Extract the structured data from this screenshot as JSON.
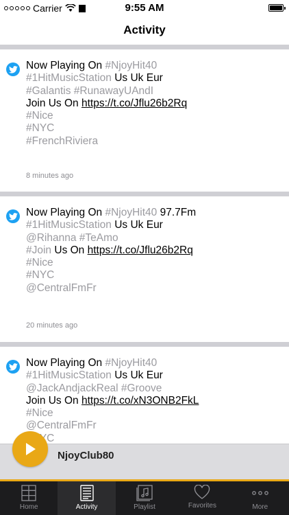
{
  "status_bar": {
    "carrier": "Carrier",
    "time": "9:55 AM"
  },
  "header": {
    "title": "Activity"
  },
  "feed": [
    {
      "lines": [
        [
          {
            "t": "Now Playing On ",
            "k": "text"
          },
          {
            "t": "#NjoyHit40",
            "k": "tag"
          }
        ],
        [
          {
            "t": "#1HitMusicStation",
            "k": "tag"
          },
          {
            "t": " Us Uk Eur",
            "k": "text"
          }
        ],
        [
          {
            "t": "#Galantis #RunawayUAndI",
            "k": "tag"
          }
        ],
        [
          {
            "t": "Join Us On ",
            "k": "text"
          },
          {
            "t": "https://t.co/Jflu26b2Rq",
            "k": "link"
          }
        ],
        [
          {
            "t": "#Nice",
            "k": "tag"
          }
        ],
        [
          {
            "t": "#NYC",
            "k": "tag"
          }
        ],
        [
          {
            "t": "#FrenchRiviera",
            "k": "tag"
          }
        ]
      ],
      "time_ago": "8 minutes ago"
    },
    {
      "lines": [
        [
          {
            "t": "Now Playing On ",
            "k": "text"
          },
          {
            "t": "#NjoyHit40",
            "k": "tag"
          },
          {
            "t": " 97.7Fm",
            "k": "text"
          }
        ],
        [
          {
            "t": "#1HitMusicStation",
            "k": "tag"
          },
          {
            "t": " Us Uk Eur",
            "k": "text"
          }
        ],
        [
          {
            "t": "@Rihanna #TeAmo",
            "k": "tag"
          }
        ],
        [
          {
            "t": "#Join",
            "k": "tag"
          },
          {
            "t": " Us On ",
            "k": "text"
          },
          {
            "t": "https://t.co/Jflu26b2Rq",
            "k": "link"
          }
        ],
        [
          {
            "t": "#Nice",
            "k": "tag"
          }
        ],
        [
          {
            "t": "#NYC",
            "k": "tag"
          }
        ],
        [
          {
            "t": "@CentralFmFr",
            "k": "tag"
          }
        ]
      ],
      "time_ago": "20 minutes ago"
    },
    {
      "lines": [
        [
          {
            "t": "Now Playing On ",
            "k": "text"
          },
          {
            "t": "#NjoyHit40",
            "k": "tag"
          }
        ],
        [
          {
            "t": "#1HitMusicStation",
            "k": "tag"
          },
          {
            "t": " Us Uk Eur",
            "k": "text"
          }
        ],
        [
          {
            "t": "@JackAndjackReal #Groove",
            "k": "tag"
          }
        ],
        [
          {
            "t": "Join Us On ",
            "k": "text"
          },
          {
            "t": "https://t.co/xN3ONB2FkL",
            "k": "link"
          }
        ],
        [
          {
            "t": "#Nice",
            "k": "tag"
          }
        ],
        [
          {
            "t": "@CentralFmFr",
            "k": "tag"
          }
        ],
        [
          {
            "t": "#NYC",
            "k": "tag"
          }
        ]
      ],
      "time_ago": ""
    }
  ],
  "player": {
    "station": "NjoyClub80"
  },
  "tabs": [
    {
      "label": "Home",
      "icon": "grid-icon"
    },
    {
      "label": "Activity",
      "icon": "document-icon"
    },
    {
      "label": "Playlist",
      "icon": "music-icon"
    },
    {
      "label": "Favorites",
      "icon": "heart-icon"
    },
    {
      "label": "More",
      "icon": "more-icon"
    }
  ],
  "colors": {
    "accent": "#e9a816",
    "twitter": "#1da1f2",
    "hashtag": "#9b9ba0",
    "tabbar": "#1c1c1e"
  }
}
